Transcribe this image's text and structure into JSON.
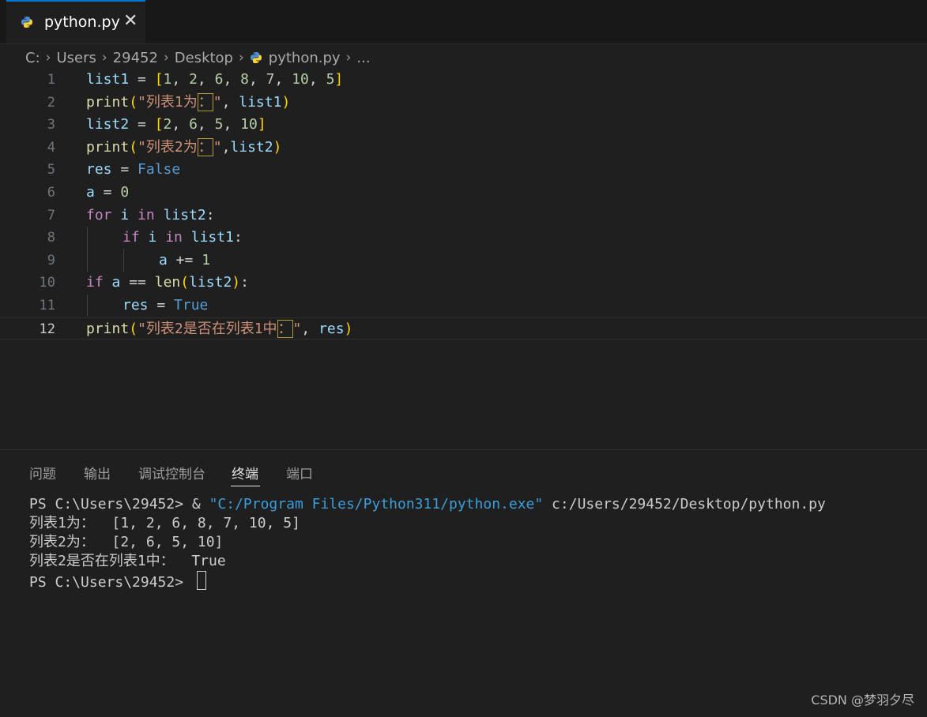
{
  "tab": {
    "title": "python.py",
    "close": "✕",
    "icon": "python-icon"
  },
  "breadcrumb": {
    "items": [
      "C:",
      "Users",
      "29452",
      "Desktop",
      "python.py",
      "..."
    ],
    "separator": "›"
  },
  "editor": {
    "current_line": 12,
    "line_numbers": [
      "1",
      "2",
      "3",
      "4",
      "5",
      "6",
      "7",
      "8",
      "9",
      "10",
      "11",
      "12"
    ],
    "lines": {
      "l1": {
        "a": "list1",
        "b": " = ",
        "c": "[",
        "d": "1",
        "e": ", ",
        "f": "2",
        "g": ", ",
        "h": "6",
        "i": ", ",
        "j": "8",
        "k": ", ",
        "l": "7",
        "m": ", ",
        "n": "10",
        "o": ", ",
        "p": "5",
        "q": "]"
      },
      "l2": {
        "a": "print",
        "b": "(",
        "c": "\"列表1为",
        "d": "：",
        "e": "\"",
        "f": ", ",
        "g": "list1",
        "h": ")"
      },
      "l3": {
        "a": "list2",
        "b": " = ",
        "c": "[",
        "d": "2",
        "e": ", ",
        "f": "6",
        "g": ", ",
        "h": "5",
        "i": ", ",
        "j": "10",
        "k": "]"
      },
      "l4": {
        "a": "print",
        "b": "(",
        "c": "\"列表2为",
        "d": "：",
        "e": "\"",
        "f": ",",
        "g": "list2",
        "h": ")"
      },
      "l5": {
        "a": "res",
        "b": " = ",
        "c": "False"
      },
      "l6": {
        "a": "a",
        "b": " = ",
        "c": "0"
      },
      "l7": {
        "a": "for",
        "b": " ",
        "c": "i",
        "d": " ",
        "e": "in",
        "f": " ",
        "g": "list2",
        "h": ":"
      },
      "l8": {
        "a": "if",
        "b": " ",
        "c": "i",
        "d": " ",
        "e": "in",
        "f": " ",
        "g": "list1",
        "h": ":"
      },
      "l9": {
        "a": "a",
        "b": " += ",
        "c": "1"
      },
      "l10": {
        "a": "if",
        "b": " ",
        "c": "a",
        "d": " == ",
        "e": "len",
        "f": "(",
        "g": "list2",
        "h": ")",
        "i": ":"
      },
      "l11": {
        "a": "res",
        "b": " = ",
        "c": "True"
      },
      "l12": {
        "a": "print",
        "b": "(",
        "c": "\"列表2是否在列表1中",
        "d": "：",
        "e": "\"",
        "f": ", ",
        "g": "res",
        "h": ")"
      }
    }
  },
  "panel": {
    "tabs": [
      "问题",
      "输出",
      "调试控制台",
      "终端",
      "端口"
    ],
    "active_tab": "终端",
    "terminal": {
      "cmd_prompt": "PS C:\\Users\\29452> & ",
      "cmd_exe": "\"C:/Program Files/Python311/python.exe\"",
      "cmd_arg": " c:/Users/29452/Desktop/python.py",
      "out1": "列表1为：  [1, 2, 6, 8, 7, 10, 5]",
      "out2": "列表2为：  [2, 6, 5, 10]",
      "out3": "列表2是否在列表1中：  True",
      "final_prompt": "PS C:\\Users\\29452> "
    }
  },
  "watermark": "CSDN @梦羽夕尽",
  "colors": {
    "accent": "#0078d4",
    "background": "#1f1f1f",
    "string": "#ce9178",
    "keyword": "#c586c0",
    "variable": "#9cdcfe",
    "number": "#b5cea8"
  }
}
